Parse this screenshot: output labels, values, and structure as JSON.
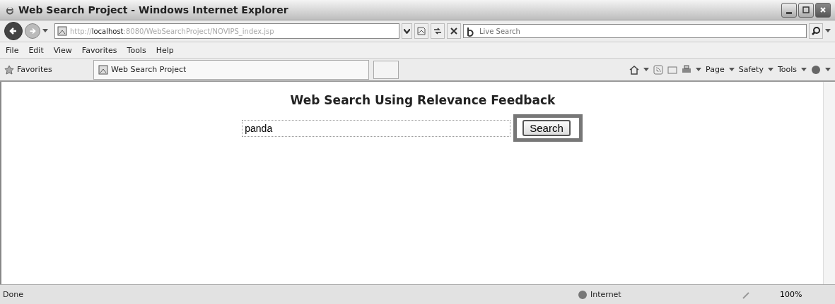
{
  "window": {
    "title": "Web Search Project - Windows Internet Explorer"
  },
  "address_bar": {
    "url_prefix": "http://",
    "url_host": "localhost",
    "url_rest": ":8080/WebSearchProject/NOVIPS_index.jsp"
  },
  "search_box": {
    "placeholder": "Live Search"
  },
  "menu": [
    "File",
    "Edit",
    "View",
    "Favorites",
    "Tools",
    "Help"
  ],
  "favorites_bar": {
    "favorites": "Favorites",
    "tab": "Web Search Project"
  },
  "command_bar": [
    "Page",
    "Safety",
    "Tools"
  ],
  "page": {
    "heading": "Web Search Using Relevance Feedback",
    "query": "panda",
    "button": "Search"
  },
  "status_bar": {
    "status": "Done",
    "zone": "Internet",
    "zoom": "100%"
  }
}
